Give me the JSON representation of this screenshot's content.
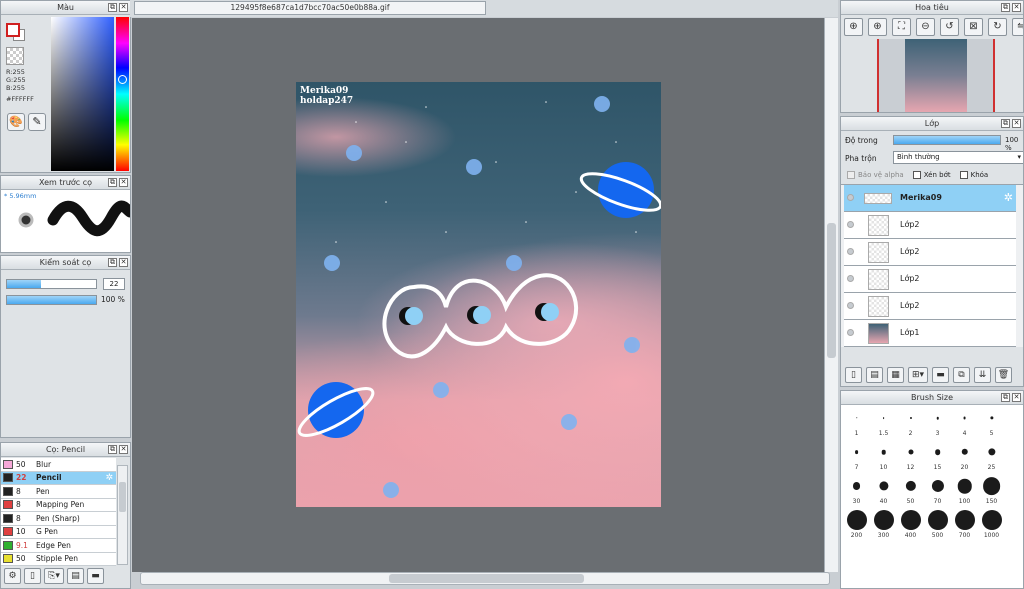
{
  "color_panel": {
    "title": "Màu",
    "rgb": [
      "R:255",
      "G:255",
      "B:255"
    ],
    "hex": "#FFFFFF",
    "hue_color": "#3060ff"
  },
  "brush_preview": {
    "title": "Xem trước cọ",
    "size": "* 5.96mm"
  },
  "brush_control": {
    "title": "Kiểm soát cọ",
    "size_value": "22",
    "opacity_value": "100 %",
    "size_fill": 0.38,
    "opacity_fill": 1.0
  },
  "brush_list": {
    "title": "Cọ: Pencil",
    "items": [
      {
        "size": "50",
        "name": "Blur",
        "color": "#f6a8d8"
      },
      {
        "size": "22",
        "name": "Pencil",
        "color": "#222222"
      },
      {
        "size": "8",
        "name": "Pen",
        "color": "#222222"
      },
      {
        "size": "8",
        "name": "Mapping Pen",
        "color": "#e04040"
      },
      {
        "size": "8",
        "name": "Pen (Sharp)",
        "color": "#222222"
      },
      {
        "size": "10",
        "name": "G Pen",
        "color": "#e04040"
      },
      {
        "size": "9.1",
        "name": "Edge Pen",
        "color": "#30b030"
      },
      {
        "size": "50",
        "name": "Stipple Pen",
        "color": "#e8e030"
      }
    ]
  },
  "document": {
    "tab": "129495f8e687ca1d7bcc70ac50e0b88a.gif"
  },
  "artwork": {
    "watermark_1": "Merika09",
    "watermark_2": "holdap247"
  },
  "navigator": {
    "title": "Hoa tiêu"
  },
  "layers": {
    "title": "Lớp",
    "opacity_label": "Độ trong",
    "opacity_value": "100 %",
    "opacity_fill": 1.0,
    "blend_label": "Pha trộn",
    "blend_value": "Bình thường",
    "protect_alpha": "Bảo vệ alpha",
    "clip": "Xén bớt",
    "lock": "Khóa",
    "items": [
      "Merika09",
      "Lớp2",
      "Lớp2",
      "Lớp2",
      "Lớp2",
      "Lớp1"
    ]
  },
  "brush_size": {
    "title": "Brush Size",
    "sizes": [
      "1",
      "1.5",
      "2",
      "3",
      "4",
      "5",
      "7",
      "10",
      "12",
      "15",
      "20",
      "25",
      "30",
      "40",
      "50",
      "70",
      "100",
      "150",
      "200",
      "300",
      "400",
      "500",
      "700",
      "1000"
    ]
  }
}
